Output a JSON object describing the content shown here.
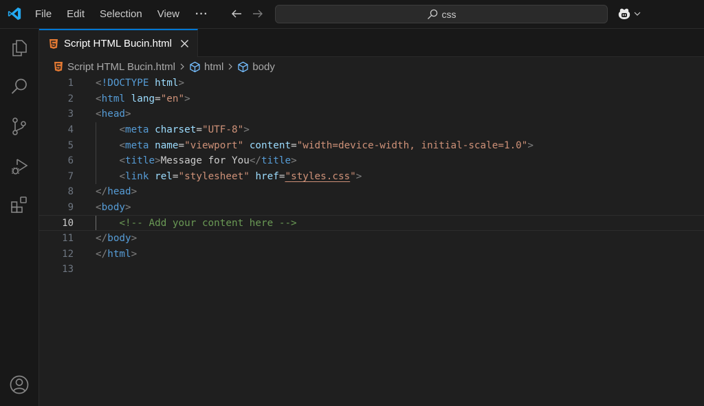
{
  "titlebar": {
    "menu": [
      "File",
      "Edit",
      "Selection",
      "View"
    ],
    "more": "···",
    "search_value": "css",
    "colors": {
      "accent": "#0078d4",
      "logo": "#23a9f2"
    }
  },
  "activity_bar": {
    "items": [
      "explorer-icon",
      "search-icon",
      "source-control-icon",
      "run-debug-icon",
      "extensions-icon"
    ],
    "bottom": [
      "account-icon"
    ]
  },
  "tab": {
    "label": "Script HTML Bucin.html",
    "icon": "html5-icon",
    "icon_color": "#e37933"
  },
  "breadcrumb": {
    "file": "Script HTML Bucin.html",
    "items": [
      "html",
      "body"
    ]
  },
  "editor": {
    "current_line": 10,
    "lines": [
      {
        "n": "1"
      },
      {
        "n": "2"
      },
      {
        "n": "3"
      },
      {
        "n": "4"
      },
      {
        "n": "5"
      },
      {
        "n": "6"
      },
      {
        "n": "7"
      },
      {
        "n": "8"
      },
      {
        "n": "9"
      },
      {
        "n": "10"
      },
      {
        "n": "11"
      },
      {
        "n": "12"
      },
      {
        "n": "13"
      }
    ],
    "tokens": {
      "doctype_kw": "!DOCTYPE",
      "doctype_val": "html",
      "html_tag": "html",
      "lang_attr": "lang",
      "lang_val": "\"en\"",
      "head_tag": "head",
      "meta_tag": "meta",
      "charset_attr": "charset",
      "charset_val": "\"UTF-8\"",
      "name_attr": "name",
      "name_val": "\"viewport\"",
      "content_attr": "content",
      "content_val": "\"width=device-width, initial-scale=1.0\"",
      "title_tag": "title",
      "title_text": "Message for You",
      "link_tag": "link",
      "rel_attr": "rel",
      "rel_val": "\"stylesheet\"",
      "href_attr": "href",
      "href_q": "\"",
      "href_val": "styles.css",
      "body_tag": "body",
      "comment": "<!-- Add your content here -->"
    }
  }
}
